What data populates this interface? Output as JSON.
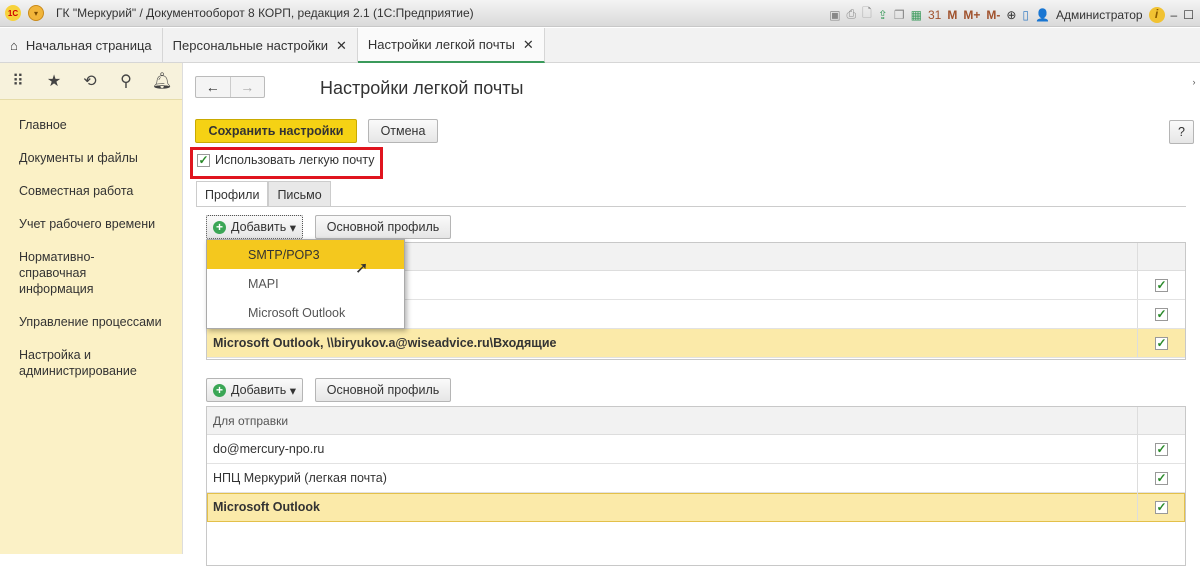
{
  "window": {
    "title": "ГК \"Меркурий\" / Документооборот 8 КОРП, редакция 2.1  (1С:Предприятие)",
    "logo": "1С",
    "user": "Администратор",
    "toolbar_m": "M",
    "toolbar_mplus": "M+",
    "toolbar_mminus": "M-"
  },
  "tabs": [
    {
      "label": "Начальная страница"
    },
    {
      "label": "Персональные настройки"
    },
    {
      "label": "Настройки легкой почты"
    }
  ],
  "sidebar": {
    "items": [
      "Главное",
      "Документы и файлы",
      "Совместная работа",
      "Учет рабочего времени",
      "Нормативно-справочная информация",
      "Управление процессами",
      "Настройка и администрирование"
    ]
  },
  "page": {
    "title": "Настройки легкой почты",
    "save": "Сохранить настройки",
    "cancel": "Отмена",
    "help": "?",
    "use_label": "Использовать легкую почту",
    "use_checked": true
  },
  "subtabs": [
    "Профили",
    "Письмо"
  ],
  "receive": {
    "add": "Добавить",
    "main_profile": "Основной профиль",
    "rows": [
      {
        "name": "",
        "checked": true
      },
      {
        "name": "",
        "checked": true
      },
      {
        "name": "Microsoft Outlook, \\\\biryukov.a@wiseadvice.ru\\Входящие",
        "checked": true
      }
    ]
  },
  "dropdown": [
    "SMTP/POP3",
    "MAPI",
    "Microsoft Outlook"
  ],
  "send": {
    "add": "Добавить",
    "main_profile": "Основной профиль",
    "header": "Для отправки",
    "rows": [
      {
        "name": "do@mercury-npo.ru",
        "checked": true
      },
      {
        "name": "НПЦ Меркурий (легкая почта)",
        "checked": true
      },
      {
        "name": "Microsoft Outlook",
        "checked": true
      }
    ]
  }
}
